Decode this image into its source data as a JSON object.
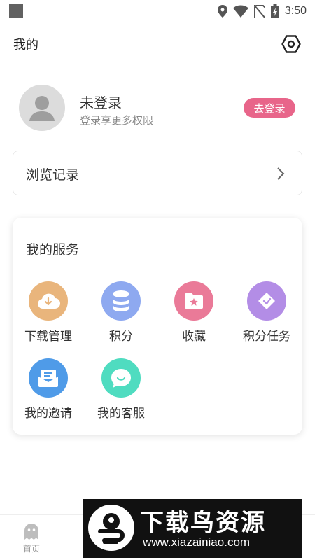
{
  "status_bar": {
    "time": "3:50"
  },
  "header": {
    "title": "我的",
    "settings_icon": "settings-hexagon-icon"
  },
  "profile": {
    "name": "未登录",
    "subtitle": "登录享更多权限",
    "login_button": "去登录",
    "accent": "#e8658a"
  },
  "history": {
    "label": "浏览记录"
  },
  "services": {
    "title": "我的服务",
    "items": [
      {
        "label": "下载管理",
        "icon": "download-cloud-icon",
        "color": "#e9b57c"
      },
      {
        "label": "积分",
        "icon": "coins-stack-icon",
        "color": "#8ea9f0"
      },
      {
        "label": "收藏",
        "icon": "folder-star-icon",
        "color": "#ea7a98"
      },
      {
        "label": "积分任务",
        "icon": "diamond-tag-icon",
        "color": "#b38de6"
      },
      {
        "label": "我的邀请",
        "icon": "envelope-icon",
        "color": "#4f9be8"
      },
      {
        "label": "我的客服",
        "icon": "chat-bubble-icon",
        "color": "#4fdcc0"
      }
    ]
  },
  "bottom_nav": {
    "home_label": "首页"
  },
  "watermark": {
    "title": "下载鸟资源",
    "url": "www.xiazainiao.com"
  }
}
